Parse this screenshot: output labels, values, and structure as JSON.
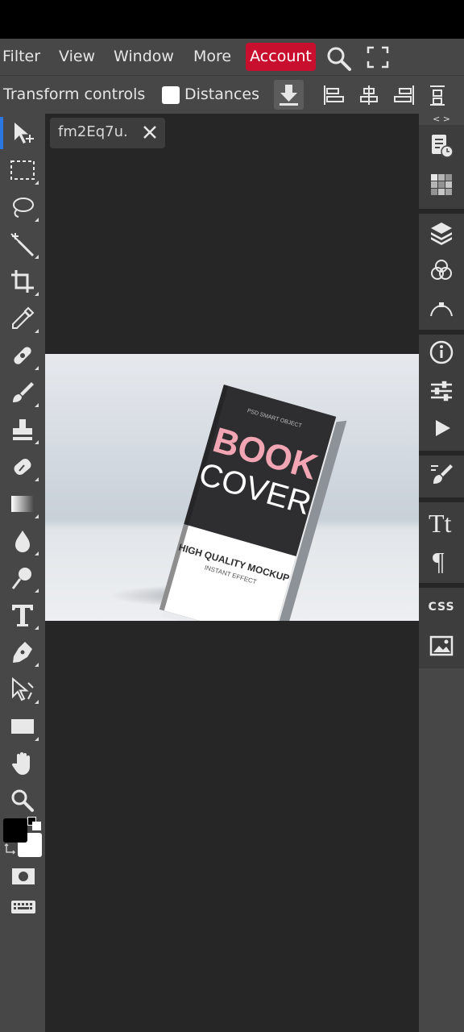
{
  "menu": {
    "items": [
      "Filter",
      "View",
      "Window",
      "More"
    ],
    "account_label": "Account"
  },
  "options_bar": {
    "transform_label": "Transform controls",
    "distances_label": "Distances",
    "distances_checked": false
  },
  "document_tab": {
    "name": "fm2Eq7u."
  },
  "right_panel": {
    "toggle_label": "< >",
    "css_label": "CSS"
  },
  "artwork": {
    "small_text": "PSD SMART OBJECT",
    "title_line1": "BOOK",
    "title_line2": "COVER",
    "subtitle": "HIGH QUALITY MOCKUP",
    "subtitle2": "INSTANT EFFECT",
    "title_color": "#f2a6b4"
  },
  "colors": {
    "accent": "#c8102e",
    "active_tool": "#2b78e4",
    "foreground": "#000000",
    "background": "#ffffff"
  }
}
